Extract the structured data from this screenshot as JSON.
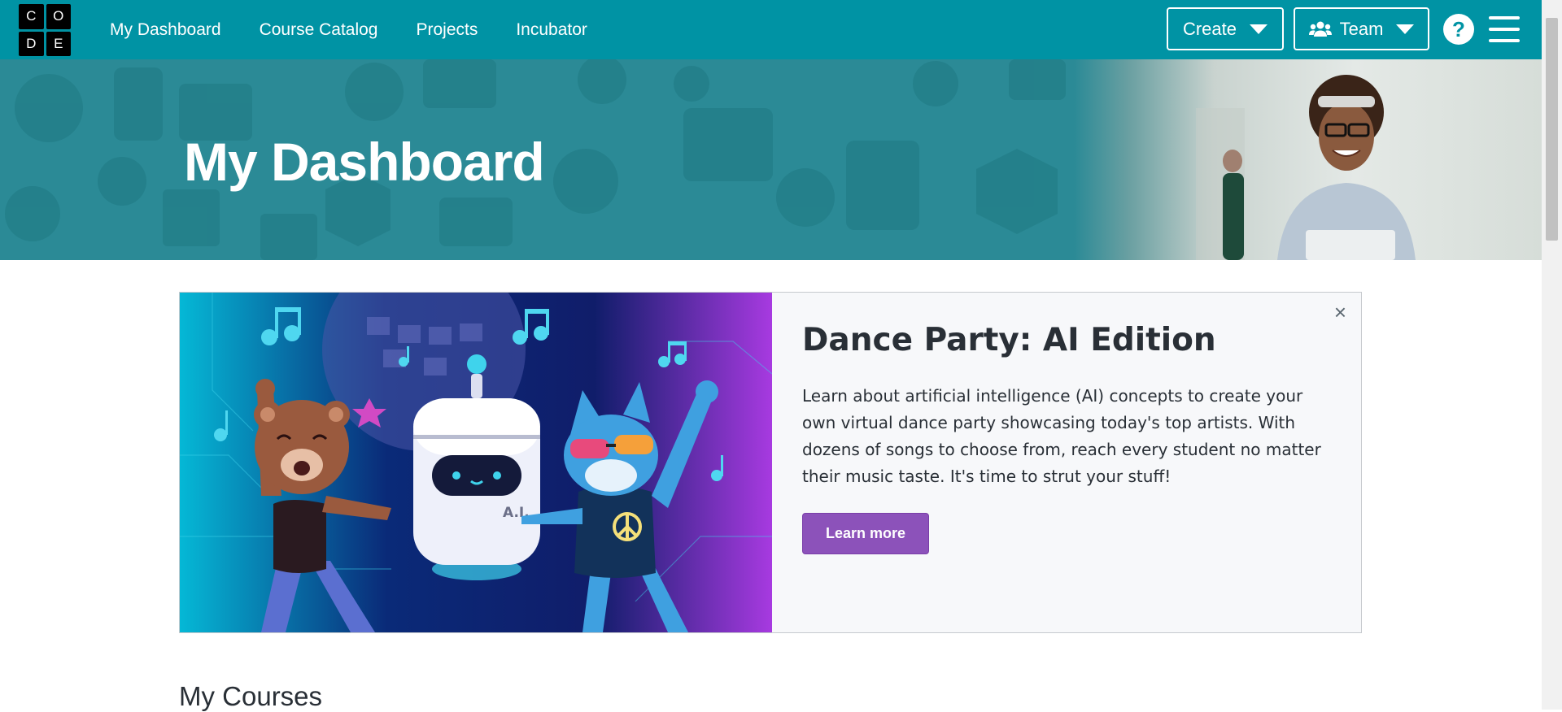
{
  "header": {
    "logo_letters": [
      "C",
      "O",
      "D",
      "E"
    ],
    "nav": [
      "My Dashboard",
      "Course Catalog",
      "Projects",
      "Incubator"
    ],
    "create_label": "Create",
    "team_label": "Team",
    "help_label": "?"
  },
  "hero": {
    "title": "My Dashboard"
  },
  "promo": {
    "title": "Dance Party: AI Edition",
    "description": "Learn about artificial intelligence (AI) concepts to create your own virtual dance party showcasing today's top artists. With dozens of songs to choose from, reach every student no matter their music taste. It's time to strut your stuff!",
    "button_label": "Learn more",
    "close_label": "×",
    "robot_label": "A.I."
  },
  "sections": {
    "my_courses_title": "My Courses"
  },
  "colors": {
    "header_bg": "#0093a4",
    "accent_purple": "#8c52ba",
    "text_dark": "#292f36"
  }
}
